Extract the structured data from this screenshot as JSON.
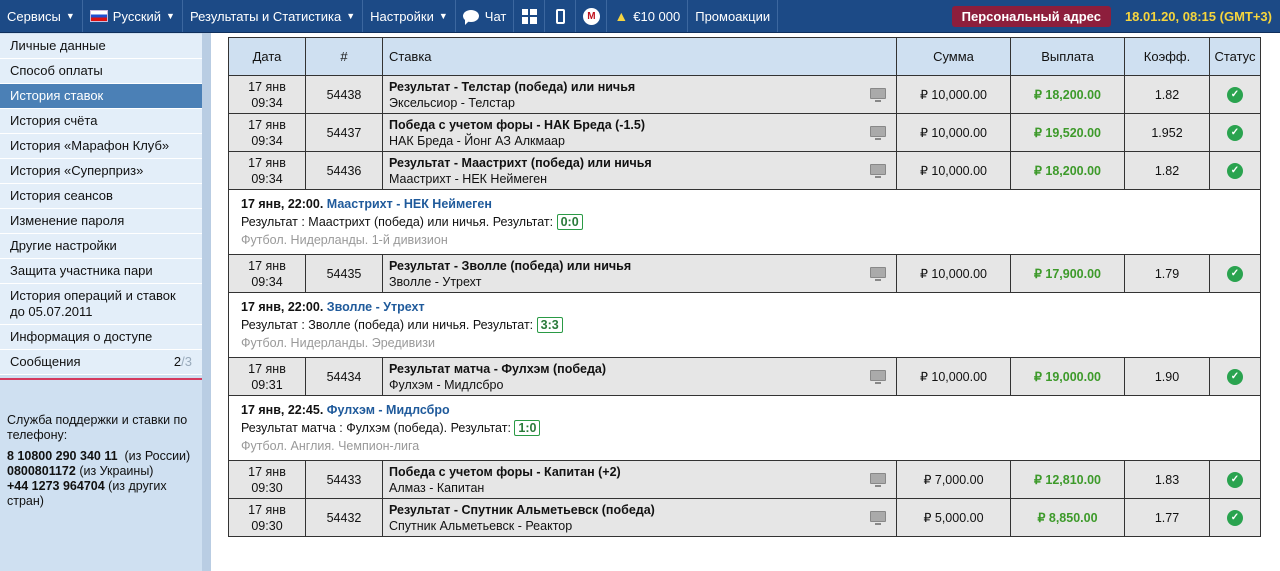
{
  "topbar": {
    "services": "Сервисы",
    "language": "Русский",
    "results": "Результаты и Статистика",
    "settings": "Настройки",
    "chat": "Чат",
    "bonus": "€10 000",
    "promo": "Промоакции",
    "personal_address": "Персональный адрес",
    "datetime": "18.01.20, 08:15 (GMT+3)"
  },
  "sidebar": {
    "items": [
      {
        "label": "Личные данные"
      },
      {
        "label": "Способ оплаты"
      },
      {
        "label": "История ставок"
      },
      {
        "label": "История счёта"
      },
      {
        "label": "История «Марафон Клуб»"
      },
      {
        "label": "История «Суперприз»"
      },
      {
        "label": "История сеансов"
      },
      {
        "label": "Изменение пароля"
      },
      {
        "label": "Другие настройки"
      },
      {
        "label": "Защита участника пари"
      },
      {
        "label": "История операций и ставок до 05.07.2011"
      },
      {
        "label": "Информация о доступе"
      },
      {
        "label": "Сообщения",
        "count": "2",
        "count_total": "3"
      }
    ],
    "support": {
      "title": "Служба поддержки и ставки по телефону:",
      "phones": [
        {
          "number": "8 10800 290 340 11",
          "note": "(из России)"
        },
        {
          "number": "0800801172",
          "note": "(из Украины)"
        },
        {
          "number": "+44 1273 964704",
          "note": "(из других стран)"
        }
      ]
    }
  },
  "table": {
    "headers": [
      "Дата",
      "#",
      "Ставка",
      "Сумма",
      "Выплата",
      "Коэфф.",
      "Статус"
    ],
    "rows": [
      {
        "date": "17 янв",
        "time": "09:34",
        "id": "54438",
        "bet": "Результат - Телстар (победа) или ничья",
        "match": "Эксельсиор - Телстар",
        "sum": "₽ 10,000.00",
        "payout": "₽ 18,200.00",
        "coef": "1.82"
      },
      {
        "date": "17 янв",
        "time": "09:34",
        "id": "54437",
        "bet": "Победа с учетом форы - НАК Бреда (-1.5)",
        "match": "НАК Бреда - Йонг АЗ Алкмаар",
        "sum": "₽ 10,000.00",
        "payout": "₽ 19,520.00",
        "coef": "1.952"
      },
      {
        "date": "17 янв",
        "time": "09:34",
        "id": "54436",
        "bet": "Результат - Маастрихт (победа) или ничья",
        "match": "Маастрихт - НЕК Неймеген",
        "sum": "₽ 10,000.00",
        "payout": "₽ 18,200.00",
        "coef": "1.82"
      },
      {
        "date": "17 янв",
        "time": "09:34",
        "id": "54435",
        "bet": "Результат - Зволле (победа) или ничья",
        "match": "Зволле - Утрехт",
        "sum": "₽ 10,000.00",
        "payout": "₽ 17,900.00",
        "coef": "1.79"
      },
      {
        "date": "17 янв",
        "time": "09:31",
        "id": "54434",
        "bet": "Результат матча - Фулхэм (победа)",
        "match": "Фулхэм - Мидлсбро",
        "sum": "₽ 10,000.00",
        "payout": "₽ 19,000.00",
        "coef": "1.90"
      },
      {
        "date": "17 янв",
        "time": "09:30",
        "id": "54433",
        "bet": "Победа с учетом форы - Капитан (+2)",
        "match": "Алмаз - Капитан",
        "sum": "₽ 7,000.00",
        "payout": "₽ 12,810.00",
        "coef": "1.83"
      },
      {
        "date": "17 янв",
        "time": "09:30",
        "id": "54432",
        "bet": "Результат - Спутник Альметьевск (победа)",
        "match": "Спутник Альметьевск - Реактор",
        "sum": "₽ 5,000.00",
        "payout": "₽ 8,850.00",
        "coef": "1.77"
      }
    ],
    "details": [
      {
        "when": "17 янв, 22:00.",
        "match": "Маастрихт - НЕК Неймеген",
        "result_text": "Результат : Маастрихт (победа) или ничья. Результат:",
        "score": "0:0",
        "league": "Футбол. Нидерланды. 1-й дивизион"
      },
      {
        "when": "17 янв, 22:00.",
        "match": "Зволле - Утрехт",
        "result_text": "Результат : Зволле (победа) или ничья. Результат:",
        "score": "3:3",
        "league": "Футбол. Нидерланды. Эредивизи"
      },
      {
        "when": "17 янв, 22:45.",
        "match": "Фулхэм - Мидлсбро",
        "result_text": "Результат матча : Фулхэм (победа). Результат:",
        "score": "1:0",
        "league": "Футбол. Англия. Чемпион-лига"
      }
    ]
  },
  "colors": {
    "topbar": "#1c4a86",
    "active_sidebar": "#4b80b6",
    "payout_green": "#3d9a2a",
    "personal_button": "#8d1e3c",
    "datetime": "#f6d53d"
  }
}
